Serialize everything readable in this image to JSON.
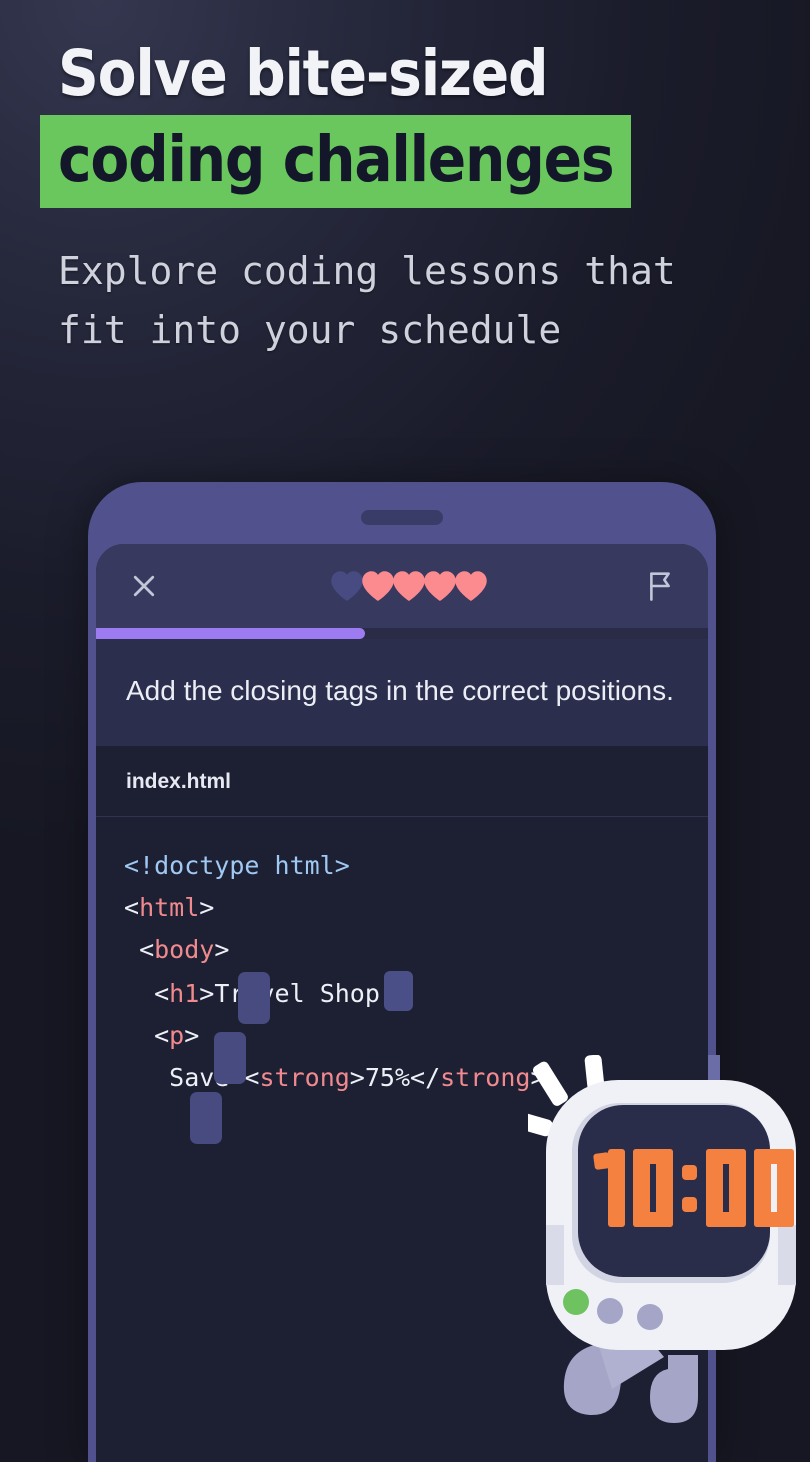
{
  "headline": {
    "line1": "Solve bite-sized",
    "line2": "coding challenges",
    "highlight_color": "#69c75d",
    "highlight_text_color": "#14162a"
  },
  "subtitle": {
    "line1": "Explore coding lessons that",
    "line2": "fit into your schedule"
  },
  "phone": {
    "topbar": {
      "close_icon": "close-x-icon",
      "flag_icon": "flag-icon",
      "hearts": [
        {
          "state": "empty"
        },
        {
          "state": "filled"
        },
        {
          "state": "filled"
        },
        {
          "state": "filled"
        },
        {
          "state": "filled"
        }
      ],
      "heart_filled_color": "#fb8b8f",
      "heart_empty_color": "#474b82"
    },
    "progress": {
      "percent": 44,
      "fill_color": "#9c7cf0",
      "track_color": "#2a2c47"
    },
    "prompt": "Add the closing tags in the correct positions.",
    "file_tab": "index.html",
    "code": {
      "lines": [
        {
          "indent": 0,
          "tokens": [
            {
              "type": "doctype",
              "text": "<!doctype html>"
            }
          ]
        },
        {
          "indent": 0,
          "tokens": [
            {
              "type": "punct",
              "text": "<"
            },
            {
              "type": "tag",
              "text": "html"
            },
            {
              "type": "punct",
              "text": ">"
            }
          ]
        },
        {
          "indent": 1,
          "tokens": [
            {
              "type": "punct",
              "text": "<"
            },
            {
              "type": "tag",
              "text": "body"
            },
            {
              "type": "punct",
              "text": ">"
            }
          ]
        },
        {
          "indent": 2,
          "tokens": [
            {
              "type": "punct",
              "text": "<"
            },
            {
              "type": "tag",
              "text": "h1"
            },
            {
              "type": "punct",
              "text": ">"
            },
            {
              "type": "text",
              "text": "Travel Shop"
            },
            {
              "type": "slot",
              "text": ""
            }
          ]
        },
        {
          "indent": 2,
          "tokens": [
            {
              "type": "punct",
              "text": "<"
            },
            {
              "type": "tag",
              "text": "p"
            },
            {
              "type": "punct",
              "text": ">"
            }
          ]
        },
        {
          "indent": 3,
          "tokens": [
            {
              "type": "text",
              "text": "Save "
            },
            {
              "type": "punct",
              "text": "<"
            },
            {
              "type": "tag",
              "text": "strong"
            },
            {
              "type": "punct",
              "text": ">"
            },
            {
              "type": "text",
              "text": "75%"
            },
            {
              "type": "punct",
              "text": "</"
            },
            {
              "type": "tag",
              "text": "strong"
            },
            {
              "type": "punct",
              "text": ">"
            }
          ]
        }
      ],
      "empty_slots": 3,
      "slot_color": "#474b80",
      "background": "#1d1f33"
    }
  },
  "mascot": {
    "name": "alarm-clock-character",
    "display_time": "10:00",
    "digit_color": "#f4813f",
    "screen_color": "#2a2d4a",
    "body_color": "#f0f1f7",
    "led_color": "#6ec25f",
    "leg_color": "#a5a5c8"
  },
  "colors": {
    "background_dark": "#16172a",
    "phone_frame": "#50518d",
    "topbar": "#373a5e",
    "prompt_panel": "#2b2e4c"
  }
}
